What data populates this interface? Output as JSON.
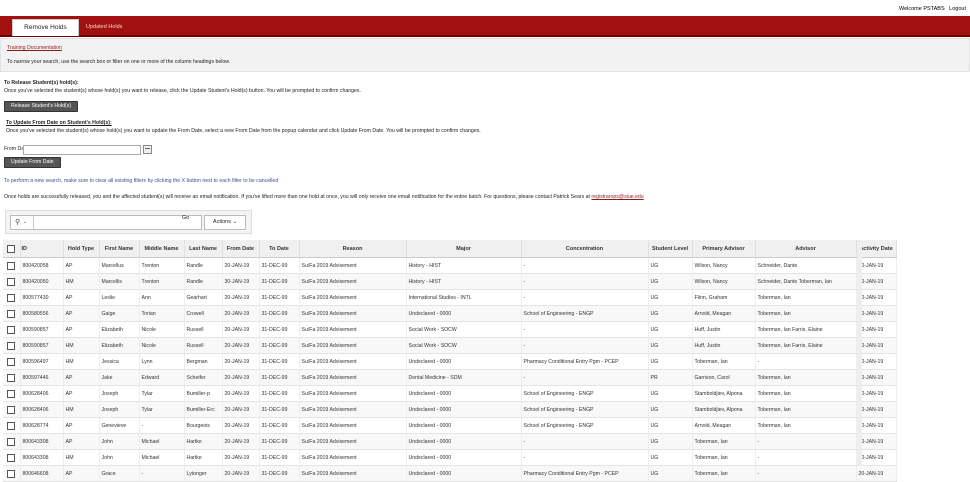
{
  "header": {
    "welcome": "Welcome PSTABS",
    "logout": "Logout"
  },
  "tabs": [
    {
      "label": "Remove Holds"
    },
    {
      "label": "Updated Holds"
    }
  ],
  "help": {
    "training_link": "Training Documentation",
    "search_hint": "To narrow your search, use the search box or filter on one or more of the column headings below."
  },
  "release": {
    "heading": "To Release Student(s) hold(s):",
    "instructions": "Once you've selected the student(s) whose hold(s) you want to release, click the Update Student's Hold(s) button. You will be prompted to confirm changes.",
    "button": "Release Student's Hold(s)"
  },
  "update": {
    "heading": "To Update From Date on Student's Hold(s):",
    "instructions": "Once you've selected the student(s) whose hold(s) you want to update the From Date, select a new From Date from the popup calendar and click Update From Date. You will be prompted to confirm changes.",
    "from_label": "From Date",
    "from_value": "",
    "button": "Update From Date"
  },
  "notes": {
    "filters": "To perform a new search, make sure to clear all existing filters by clicking the X button next to each filter to be cancelled",
    "email": "Once holds are successfully released, you and the affected student(s) will receive an email notification. If you've lifted more than one hold at once, you will only receive one email notification for the entire batch. For questions, please contact Patrick Sears at",
    "email_link": "registrarops@siue.edu"
  },
  "toolbar": {
    "go": "Go",
    "actions": "Actions"
  },
  "table": {
    "columns": [
      "ID",
      "Hold Type",
      "First Name",
      "Middle Name",
      "Last Name",
      "From Date",
      "To Date",
      "Reason",
      "Major",
      "Concentration",
      "Student Level",
      "Primary Advisor",
      "Advisor",
      "Activity Date"
    ],
    "rows": [
      [
        "800420058",
        "AP",
        "Marcellus",
        "Trenton",
        "Randle",
        "20-JAN-19",
        "31-DEC-99",
        "Su/Fa 2019 Advisement",
        "History - HIST",
        "-",
        "UG",
        "Wilson, Nancy",
        "Schneider, Dante",
        "20-JAN-19"
      ],
      [
        "800420050",
        "HM",
        "Marcellis",
        "Trenton",
        "Randle",
        "30-JAN-19",
        "31-DEC-99",
        "Su/Fa 2019 Advisement",
        "History - HIST",
        "-",
        "UG",
        "Wilson, Nancy",
        "Schneider, Dante   Toberman, Ian",
        "30-JAN-19"
      ],
      [
        "800577430",
        "AP",
        "Leslie",
        "Ann",
        "Gearhart",
        "20-JAN-19",
        "31-DEC-99",
        "Su/Fa 2019 Advisement",
        "International Studies - INTL",
        "-",
        "UG",
        "Flinn, Graham",
        "Toberman, Ian",
        "20-JAN-19"
      ],
      [
        "800580556",
        "AP",
        "Gaige",
        "Torian",
        "Crowell",
        "20-JAN-19",
        "31-DEC-99",
        "Su/Fa 2019 Advisement",
        "Undeclared - 0000",
        "School of Engineering - ENGP",
        "UG",
        "Arnold, Meagan",
        "Toberman, Ian",
        "20-JAN-19"
      ],
      [
        "800590857",
        "AP",
        "Elizabeth",
        "Nicole",
        "Russell",
        "20-JAN-19",
        "31-DEC-99",
        "Su/Fa 2019 Advisement",
        "Social Work - SOCW",
        "-",
        "UG",
        "Huff, Justin",
        "Toberman, Ian   Farris, Elaine",
        "20-JAN-19"
      ],
      [
        "800590857",
        "HM",
        "Elizabeth",
        "Nicole",
        "Russell",
        "20-JAN-19",
        "31-DEC-99",
        "Su/Fa 2019 Advisement",
        "Social Work - SOCW",
        "-",
        "UG",
        "Huff, Justin",
        "Toberman, Ian   Farris, Elaine",
        "20-JAN-19"
      ],
      [
        "800596497",
        "HM",
        "Jessica",
        "Lynn",
        "Bergman",
        "20-JAN-19",
        "31-DEC-99",
        "Su/Fa 2019 Advisement",
        "Undeclared - 0000",
        "Pharmacy Conditional Entry Pgm - PCEP",
        "UG",
        "Toberman, Ian",
        "-",
        "20-JAN-19"
      ],
      [
        "800597446",
        "AP",
        "Jake",
        "Edward",
        "Scheifer",
        "20-JAN-19",
        "31-DEC-99",
        "Su/Fa 2019 Advisement",
        "Dental Medicine - SDM",
        "-",
        "PR",
        "Garrison, Carol",
        "Toberman, Ian",
        "20-JAN-19"
      ],
      [
        "800628406",
        "AP",
        "Joseph",
        "Tylar",
        "Bumiller-p",
        "20-JAN-19",
        "31-DEC-99",
        "Su/Fa 2019 Advisement",
        "Undeclared - 0000",
        "School of Engineering - ENGP",
        "UG",
        "Stamboldjiev, Alpona",
        "Toberman, Ian",
        "20-JAN-19"
      ],
      [
        "800628406",
        "HM",
        "Joseph",
        "Tylar",
        "Bumiller-Erc",
        "20-JAN-19",
        "31-DEC-99",
        "Su/Fa 2019 Advisement",
        "Undeclared - 0000",
        "School of Engineering - ENGP",
        "UG",
        "Stamboldjiev, Alpona",
        "Toberman, Ian",
        "20-JAN-19"
      ],
      [
        "800628774",
        "AP",
        "Genevieve",
        "-",
        "Bourgeois",
        "20-JAN-19",
        "31-DEC-99",
        "Su/Fa 2019 Advisement",
        "Undeclared - 0000",
        "School of Engineering - ENGP",
        "UG",
        "Arnold, Meagan",
        "Toberman, Ian",
        "20-JAN-19"
      ],
      [
        "800643308",
        "AP",
        "John",
        "Michael",
        "Hartke",
        "20-JAN-19",
        "31-DEC-99",
        "Su/Fa 2019 Advisement",
        "Undeclared - 0000",
        "-",
        "UG",
        "Toberman, Ian",
        "-",
        "20-JAN-19"
      ],
      [
        "800643308",
        "HM",
        "John",
        "Michael",
        "Hartke",
        "20-JAN-19",
        "31-DEC-99",
        "Su/Fa 2019 Advisement",
        "Undeclared - 0000",
        "-",
        "UG",
        "Toberman, Ian",
        "-",
        "20-JAN-19"
      ],
      [
        "800646608",
        "AP",
        "Grace",
        "-",
        "Lytonger",
        "20-JAN-19",
        "31-DEC-99",
        "Su/Fa 2019 Advisement",
        "Undeclared - 0000",
        "Pharmacy Conditional Entry Pgm - PCEP",
        "UG",
        "Toberman, Ian",
        "-",
        "20-JAN-19"
      ]
    ]
  }
}
